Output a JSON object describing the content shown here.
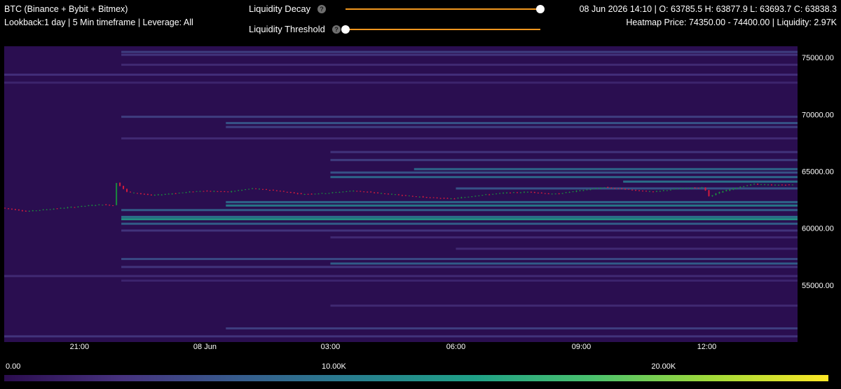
{
  "header": {
    "symbol": "BTC (Binance + Bybit + Bitmex)",
    "info": "Lookback:1 day | 5 Min timeframe | Leverage: All",
    "ohlc": "08 Jun 2026 14:10 | O: 63785.5 H: 63877.9 L: 63693.7 C: 63838.3",
    "heatmap_info": "Heatmap Price: 74350.00 - 74400.00 | Liquidity: 2.97K"
  },
  "controls": {
    "decay_label": "Liquidity Decay",
    "decay_value": 1.0,
    "threshold_label": "Liquidity Threshold",
    "threshold_value": 0.0,
    "help_glyph": "?",
    "help_icon": "question-circle-icon",
    "slider_color": "#f0961e"
  },
  "chart_data": {
    "type": "heatmap",
    "x_ticks": [
      "21:00",
      "08 Jun",
      "03:00",
      "06:00",
      "09:00",
      "12:00"
    ],
    "x_tick_hours": [
      -3,
      0,
      3,
      6,
      9,
      12
    ],
    "x_range_hours": [
      -4.8,
      14.17
    ],
    "y_ticks": [
      75000,
      70000,
      65000,
      60000,
      55000
    ],
    "y_tick_labels": [
      "75000.00",
      "70000.00",
      "65000.00",
      "60000.00",
      "55000.00"
    ],
    "ylim": [
      50000,
      76000
    ],
    "heatmap_start_hours": -2.0,
    "liquidity_levels": [
      {
        "price": 75500,
        "liq": 5000,
        "from": -2.0
      },
      {
        "price": 75250,
        "liq": 4000,
        "from": -2.0
      },
      {
        "price": 74375,
        "liq": 3000,
        "from": -2.0
      },
      {
        "price": 73500,
        "liq": 3500,
        "from": -4.8
      },
      {
        "price": 72800,
        "liq": 2500,
        "from": -4.8
      },
      {
        "price": 69800,
        "liq": 5000,
        "from": -2.0
      },
      {
        "price": 69250,
        "liq": 7000,
        "from": 0.5
      },
      {
        "price": 68900,
        "liq": 5000,
        "from": 0.5
      },
      {
        "price": 67900,
        "liq": 3000,
        "from": -2.0
      },
      {
        "price": 66700,
        "liq": 4000,
        "from": 3.0
      },
      {
        "price": 66000,
        "liq": 5000,
        "from": 3.0
      },
      {
        "price": 65200,
        "liq": 9000,
        "from": 5.0
      },
      {
        "price": 64900,
        "liq": 7000,
        "from": 3.0
      },
      {
        "price": 64500,
        "liq": 9000,
        "from": 3.0
      },
      {
        "price": 64100,
        "liq": 10000,
        "from": 10.0
      },
      {
        "price": 63500,
        "liq": 7000,
        "from": 6.0
      },
      {
        "price": 62300,
        "liq": 9000,
        "from": 0.5
      },
      {
        "price": 62000,
        "liq": 11000,
        "from": 0.5
      },
      {
        "price": 61600,
        "liq": 8000,
        "from": -2.0
      },
      {
        "price": 61000,
        "liq": 10000,
        "from": -2.0
      },
      {
        "price": 60800,
        "liq": 14000,
        "from": -2.0
      },
      {
        "price": 60400,
        "liq": 8000,
        "from": -2.0
      },
      {
        "price": 59800,
        "liq": 4000,
        "from": -2.0
      },
      {
        "price": 59200,
        "liq": 3000,
        "from": 3.0
      },
      {
        "price": 58200,
        "liq": 3000,
        "from": 6.0
      },
      {
        "price": 57300,
        "liq": 6000,
        "from": -2.0
      },
      {
        "price": 56900,
        "liq": 8000,
        "from": 3.0
      },
      {
        "price": 56600,
        "liq": 4000,
        "from": -2.0
      },
      {
        "price": 55800,
        "liq": 3000,
        "from": -4.8
      },
      {
        "price": 55400,
        "liq": 2500,
        "from": -2.0
      },
      {
        "price": 53200,
        "liq": 3000,
        "from": 3.0
      },
      {
        "price": 51200,
        "liq": 5000,
        "from": 0.5
      },
      {
        "price": 50500,
        "liq": 4000,
        "from": -4.8
      }
    ],
    "price_path": [
      [
        -4.8,
        61800
      ],
      [
        -4.2,
        61500
      ],
      [
        -3.6,
        61700
      ],
      [
        -3.0,
        61900
      ],
      [
        -2.4,
        62100
      ],
      [
        -2.1,
        62000
      ],
      [
        -2.05,
        64000
      ],
      [
        -1.8,
        63200
      ],
      [
        -1.2,
        62900
      ],
      [
        -0.6,
        63100
      ],
      [
        0.0,
        63300
      ],
      [
        0.6,
        63200
      ],
      [
        1.2,
        63500
      ],
      [
        1.8,
        63300
      ],
      [
        2.4,
        63000
      ],
      [
        3.0,
        63100
      ],
      [
        3.6,
        63300
      ],
      [
        4.2,
        63100
      ],
      [
        4.8,
        62900
      ],
      [
        5.4,
        62700
      ],
      [
        6.0,
        62600
      ],
      [
        6.6,
        62900
      ],
      [
        7.2,
        63100
      ],
      [
        7.8,
        63200
      ],
      [
        8.4,
        63000
      ],
      [
        9.0,
        63300
      ],
      [
        9.6,
        63600
      ],
      [
        10.2,
        63400
      ],
      [
        10.8,
        63200
      ],
      [
        11.4,
        63500
      ],
      [
        12.0,
        63600
      ],
      [
        12.1,
        62800
      ],
      [
        12.4,
        63200
      ],
      [
        12.8,
        63600
      ],
      [
        13.2,
        63900
      ],
      [
        13.6,
        63800
      ],
      [
        14.17,
        63838
      ]
    ],
    "colorbar": {
      "min": 0,
      "max": 25000,
      "ticks": [
        0,
        10000,
        20000
      ],
      "tick_labels": [
        "0.00",
        "10.00K",
        "20.00K"
      ],
      "colors": [
        "#2b0d4f",
        "#46327e",
        "#365c8d",
        "#277f8e",
        "#1fa187",
        "#4ac16d",
        "#a0da39",
        "#fde725"
      ]
    },
    "bg_color": "#2a0e50",
    "up_color": "#1b8a3e",
    "down_color": "#d81b3c"
  }
}
